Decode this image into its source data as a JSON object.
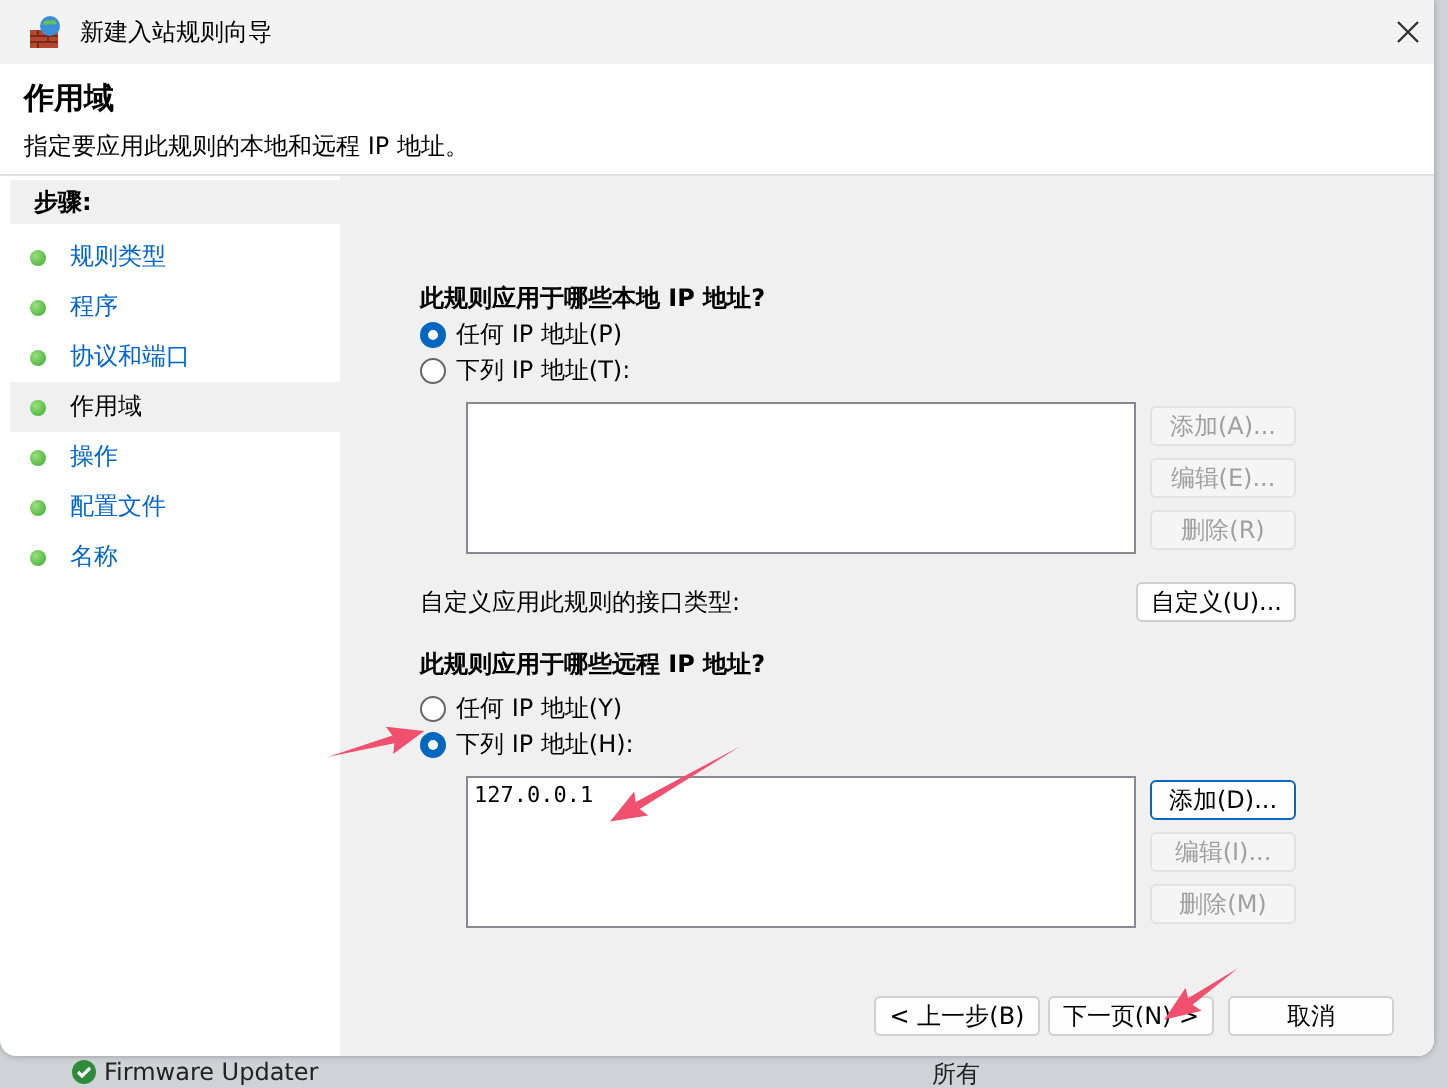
{
  "window": {
    "title": "新建入站规则向导"
  },
  "header": {
    "title": "作用域",
    "subtitle": "指定要应用此规则的本地和远程 IP 地址。"
  },
  "steps": {
    "heading": "步骤:",
    "items": [
      {
        "label": "规则类型",
        "selected": false
      },
      {
        "label": "程序",
        "selected": false
      },
      {
        "label": "协议和端口",
        "selected": false
      },
      {
        "label": "作用域",
        "selected": true
      },
      {
        "label": "操作",
        "selected": false
      },
      {
        "label": "配置文件",
        "selected": false
      },
      {
        "label": "名称",
        "selected": false
      }
    ]
  },
  "local": {
    "question": "此规则应用于哪些本地 IP 地址?",
    "options": [
      {
        "label": "任何 IP 地址(P)",
        "selected": true
      },
      {
        "label": "下列 IP 地址(T):",
        "selected": false
      }
    ],
    "buttons": [
      {
        "label": "添加(A)...",
        "disabled": true,
        "focused": false
      },
      {
        "label": "编辑(E)...",
        "disabled": true,
        "focused": false
      },
      {
        "label": "删除(R)",
        "disabled": true,
        "focused": false
      }
    ]
  },
  "interface": {
    "label": "自定义应用此规则的接口类型:",
    "button": "自定义(U)..."
  },
  "remote": {
    "question": "此规则应用于哪些远程 IP 地址?",
    "options": [
      {
        "label": "任何 IP 地址(Y)",
        "selected": false
      },
      {
        "label": "下列 IP 地址(H):",
        "selected": true
      }
    ],
    "addresses": [
      "127.0.0.1"
    ],
    "buttons": [
      {
        "label": "添加(D)...",
        "disabled": false,
        "focused": true
      },
      {
        "label": "编辑(I)...",
        "disabled": true,
        "focused": false
      },
      {
        "label": "删除(M)",
        "disabled": true,
        "focused": false
      }
    ]
  },
  "footer": {
    "buttons": [
      "< 上一步(B)",
      "下一页(N) >",
      "取消"
    ]
  },
  "background_window": {
    "row": {
      "name": "Firmware Updater",
      "column_2": "所有"
    }
  }
}
